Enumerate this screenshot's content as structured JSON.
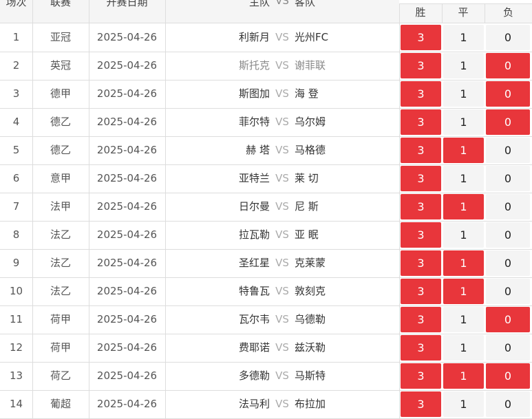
{
  "header": {
    "no": "场次",
    "league": "联赛",
    "date": "开赛日期",
    "match_home": "主队",
    "match_vs": "VS",
    "match_away": "客队",
    "win": "胜",
    "draw": "平",
    "lose": "负"
  },
  "colors": {
    "selected": "#e8363b",
    "unselected": "#f4f4f4"
  },
  "rows": [
    {
      "no": "1",
      "league": "亚冠",
      "date": "2025-04-26",
      "home": "利新月",
      "vs": "VS",
      "away": "光州FC",
      "win": "3",
      "draw": "1",
      "lose": "0",
      "win_sel": true,
      "draw_sel": false,
      "lose_sel": false,
      "muted": false
    },
    {
      "no": "2",
      "league": "英冠",
      "date": "2025-04-26",
      "home": "斯托克",
      "vs": "VS",
      "away": "谢菲联",
      "win": "3",
      "draw": "1",
      "lose": "0",
      "win_sel": true,
      "draw_sel": false,
      "lose_sel": true,
      "muted": true
    },
    {
      "no": "3",
      "league": "德甲",
      "date": "2025-04-26",
      "home": "斯图加",
      "vs": "VS",
      "away": "海 登",
      "win": "3",
      "draw": "1",
      "lose": "0",
      "win_sel": true,
      "draw_sel": false,
      "lose_sel": true,
      "muted": false
    },
    {
      "no": "4",
      "league": "德乙",
      "date": "2025-04-26",
      "home": "菲尔特",
      "vs": "VS",
      "away": "乌尔姆",
      "win": "3",
      "draw": "1",
      "lose": "0",
      "win_sel": true,
      "draw_sel": false,
      "lose_sel": true,
      "muted": false
    },
    {
      "no": "5",
      "league": "德乙",
      "date": "2025-04-26",
      "home": "赫 塔",
      "vs": "VS",
      "away": "马格德",
      "win": "3",
      "draw": "1",
      "lose": "0",
      "win_sel": true,
      "draw_sel": true,
      "lose_sel": false,
      "muted": false
    },
    {
      "no": "6",
      "league": "意甲",
      "date": "2025-04-26",
      "home": "亚特兰",
      "vs": "VS",
      "away": "莱 切",
      "win": "3",
      "draw": "1",
      "lose": "0",
      "win_sel": true,
      "draw_sel": false,
      "lose_sel": false,
      "muted": false
    },
    {
      "no": "7",
      "league": "法甲",
      "date": "2025-04-26",
      "home": "日尔曼",
      "vs": "VS",
      "away": "尼 斯",
      "win": "3",
      "draw": "1",
      "lose": "0",
      "win_sel": true,
      "draw_sel": true,
      "lose_sel": false,
      "muted": false
    },
    {
      "no": "8",
      "league": "法乙",
      "date": "2025-04-26",
      "home": "拉瓦勒",
      "vs": "VS",
      "away": "亚 眠",
      "win": "3",
      "draw": "1",
      "lose": "0",
      "win_sel": true,
      "draw_sel": false,
      "lose_sel": false,
      "muted": false
    },
    {
      "no": "9",
      "league": "法乙",
      "date": "2025-04-26",
      "home": "圣红星",
      "vs": "VS",
      "away": "克莱蒙",
      "win": "3",
      "draw": "1",
      "lose": "0",
      "win_sel": true,
      "draw_sel": true,
      "lose_sel": false,
      "muted": false
    },
    {
      "no": "10",
      "league": "法乙",
      "date": "2025-04-26",
      "home": "特鲁瓦",
      "vs": "VS",
      "away": "敦刻克",
      "win": "3",
      "draw": "1",
      "lose": "0",
      "win_sel": true,
      "draw_sel": true,
      "lose_sel": false,
      "muted": false
    },
    {
      "no": "11",
      "league": "荷甲",
      "date": "2025-04-26",
      "home": "瓦尔韦",
      "vs": "VS",
      "away": "乌德勒",
      "win": "3",
      "draw": "1",
      "lose": "0",
      "win_sel": true,
      "draw_sel": false,
      "lose_sel": true,
      "muted": false
    },
    {
      "no": "12",
      "league": "荷甲",
      "date": "2025-04-26",
      "home": "费耶诺",
      "vs": "VS",
      "away": "兹沃勒",
      "win": "3",
      "draw": "1",
      "lose": "0",
      "win_sel": true,
      "draw_sel": false,
      "lose_sel": false,
      "muted": false
    },
    {
      "no": "13",
      "league": "荷乙",
      "date": "2025-04-26",
      "home": "多德勒",
      "vs": "VS",
      "away": "马斯特",
      "win": "3",
      "draw": "1",
      "lose": "0",
      "win_sel": true,
      "draw_sel": true,
      "lose_sel": true,
      "muted": false
    },
    {
      "no": "14",
      "league": "葡超",
      "date": "2025-04-26",
      "home": "法马利",
      "vs": "VS",
      "away": "布拉加",
      "win": "3",
      "draw": "1",
      "lose": "0",
      "win_sel": true,
      "draw_sel": false,
      "lose_sel": false,
      "muted": false
    }
  ]
}
